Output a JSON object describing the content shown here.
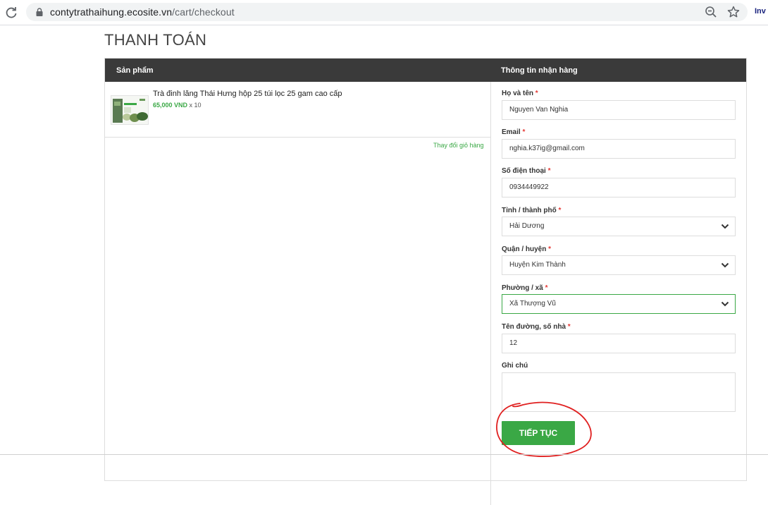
{
  "browser": {
    "url_domain": "contytrathaihung.ecosite.vn",
    "url_path": "/cart/checkout",
    "extension_label": "Inv"
  },
  "page": {
    "title": "THANH TOÁN"
  },
  "cart": {
    "header_label": "Sản phẩm",
    "items": [
      {
        "name": "Trà đinh lăng Thái Hưng hộp 25 túi lọc 25 gam cao cấp",
        "price": "65,000 VND",
        "quantity": "x 10"
      }
    ],
    "change_cart_label": "Thay đổi giỏ hàng"
  },
  "shipping_form": {
    "header_label": "Thông tin nhận hàng",
    "required_mark": "*",
    "fields": [
      {
        "label": "Họ và tên",
        "required": true,
        "type": "text",
        "value": "Nguyen Van Nghia"
      },
      {
        "label": "Email",
        "required": true,
        "type": "text",
        "value": "nghia.k37ig@gmail.com"
      },
      {
        "label": "Số điện thoại",
        "required": true,
        "type": "text",
        "value": "0934449922"
      },
      {
        "label": "Tỉnh / thành phố",
        "required": true,
        "type": "select",
        "value": "Hải Dương"
      },
      {
        "label": "Quận / huyện",
        "required": true,
        "type": "select",
        "value": "Huyện Kim Thành"
      },
      {
        "label": "Phường / xã",
        "required": true,
        "type": "select",
        "value": "Xã Thượng Vũ"
      },
      {
        "label": "Tên đường, số nhà",
        "required": true,
        "type": "text",
        "value": "12"
      },
      {
        "label": "Ghi chú",
        "required": false,
        "type": "textarea",
        "value": ""
      }
    ],
    "submit_label": "TIẾP TỤC"
  },
  "colors": {
    "accent_green": "#3aa845",
    "header_dark": "#3a3a3a",
    "required_red": "#e53935",
    "annotation_red": "#e02020"
  }
}
